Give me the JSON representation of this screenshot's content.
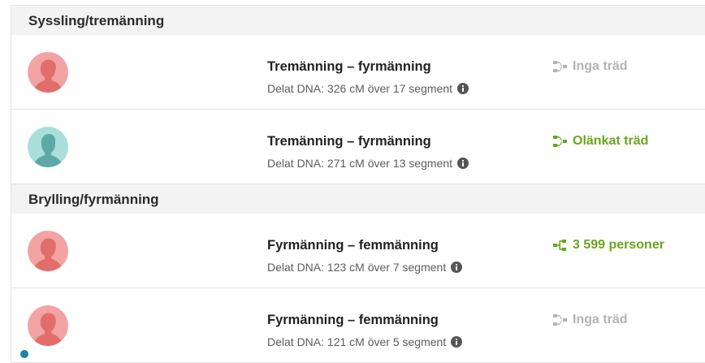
{
  "sections": [
    {
      "title": "Syssling/tremänning",
      "matches": [
        {
          "avatar": "female-silhouette-icon",
          "avatar_color": "#f2a3a3",
          "avatar_fg": "#e16e6a",
          "relationship": "Tremänning – fyrmänning",
          "dna": "Delat DNA: 326 cM över 17 segment",
          "tree_icon": "tree-unlinked-icon",
          "tree_status": "Inga träd",
          "tree_color": "#b4b4b4",
          "new_indicator": false
        },
        {
          "avatar": "male-silhouette-icon",
          "avatar_color": "#a9dedb",
          "avatar_fg": "#5ea9a6",
          "relationship": "Tremänning – fyrmänning",
          "dna": "Delat DNA: 271 cM över 13 segment",
          "tree_icon": "tree-unlinked-icon",
          "tree_status": "Olänkat träd",
          "tree_color": "#6aa51d",
          "new_indicator": false
        }
      ]
    },
    {
      "title": "Brylling/fyrmänning",
      "matches": [
        {
          "avatar": "female-silhouette-icon",
          "avatar_color": "#f2a3a3",
          "avatar_fg": "#e16e6a",
          "relationship": "Fyrmänning – femmänning",
          "dna": "Delat DNA: 123 cM över 7 segment",
          "tree_icon": "tree-linked-icon",
          "tree_status": "3 599 personer",
          "tree_color": "#6aa51d",
          "new_indicator": false
        },
        {
          "avatar": "female-silhouette-icon",
          "avatar_color": "#f2a3a3",
          "avatar_fg": "#e16e6a",
          "relationship": "Fyrmänning – femmänning",
          "dna": "Delat DNA: 121 cM över 5 segment",
          "tree_icon": "tree-unlinked-icon",
          "tree_status": "Inga träd",
          "tree_color": "#b4b4b4",
          "new_indicator": true
        }
      ]
    }
  ]
}
